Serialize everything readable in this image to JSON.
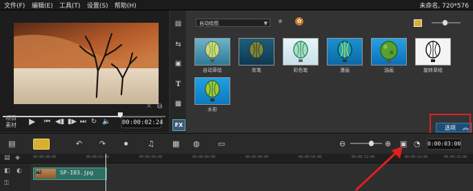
{
  "menubar": {
    "items": [
      {
        "label": "文件(F)"
      },
      {
        "label": "编辑(E)"
      },
      {
        "label": "工具(T)"
      },
      {
        "label": "设置(S)"
      },
      {
        "label": "帮助(H)"
      }
    ],
    "project_info": "未命名, 720*576"
  },
  "preview": {
    "side_labels": {
      "project": "项目",
      "clip": "素材"
    },
    "timecode": "00:00:02:24",
    "scrub_progress": 0.72,
    "buttons": [
      "play-icon",
      "go-start-icon",
      "step-back-icon",
      "step-forward-icon",
      "go-end-icon",
      "repeat-icon",
      "volume-icon"
    ]
  },
  "library": {
    "category": "自动绘图",
    "items": [
      {
        "label": "自动草绘"
      },
      {
        "label": "炭笔"
      },
      {
        "label": "彩色笔"
      },
      {
        "label": "漫画"
      },
      {
        "label": "油画"
      },
      {
        "label": "旋转草绘"
      },
      {
        "label": "水彩"
      }
    ],
    "options_label": "选项"
  },
  "timeline": {
    "timecode": "0:00:03:00",
    "zoom_level": 0.65,
    "ruler_ticks": [
      "00:00:00:00",
      "00:00:02:00",
      "00:00:04:00",
      "00:00:06:00",
      "00:00:08:00",
      "00:00:10:00",
      "00:00:12:00",
      "00:00:14:00",
      "00:00:16:00"
    ],
    "clip_name": "SP-I03.jpg",
    "clip_badge": "FX"
  },
  "colors": {
    "accent_blue": "#1c4f7a",
    "highlight_red": "#e02020",
    "clip_teal": "#2f6f64"
  }
}
